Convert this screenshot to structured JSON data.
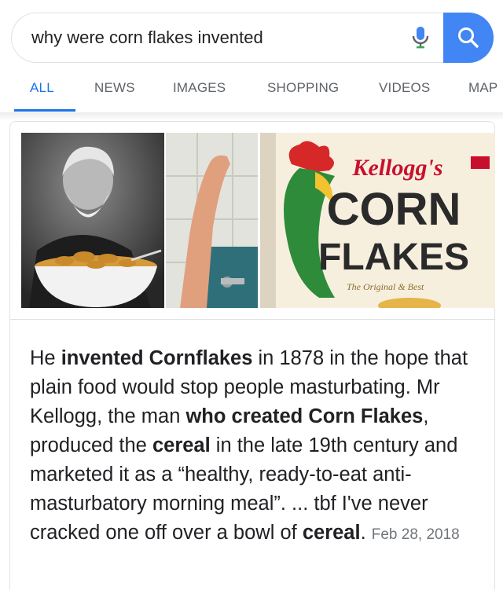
{
  "search": {
    "query": "why were corn flakes invented"
  },
  "tabs": [
    {
      "label": "ALL"
    },
    {
      "label": "NEWS"
    },
    {
      "label": "IMAGES"
    },
    {
      "label": "SHOPPING"
    },
    {
      "label": "VIDEOS"
    },
    {
      "label": "MAP"
    }
  ],
  "images": {
    "box_brand": "Kellogg's",
    "box_line1": "CORN",
    "box_line2": "FLAKES",
    "box_tagline": "The Original & Best"
  },
  "snippet": {
    "p1": "He ",
    "b1": "invented Cornflakes",
    "p2": " in 1878 in the hope that plain food would stop people masturbating. Mr Kellogg, the man ",
    "b2": "who created Corn Flakes",
    "p3": ", produced the ",
    "b3": "cereal",
    "p4": " in the late 19th century and marketed it as a “healthy, ready-to-eat anti-masturbatory morning meal”. ... tbf I've never cracked one off over a bowl of ",
    "b4": "cereal",
    "p5": ". ",
    "date": "Feb 28, 2018"
  },
  "colors": {
    "accent": "#1a73e8",
    "search_button": "#4285f4",
    "tab_inactive": "#5f6368"
  }
}
